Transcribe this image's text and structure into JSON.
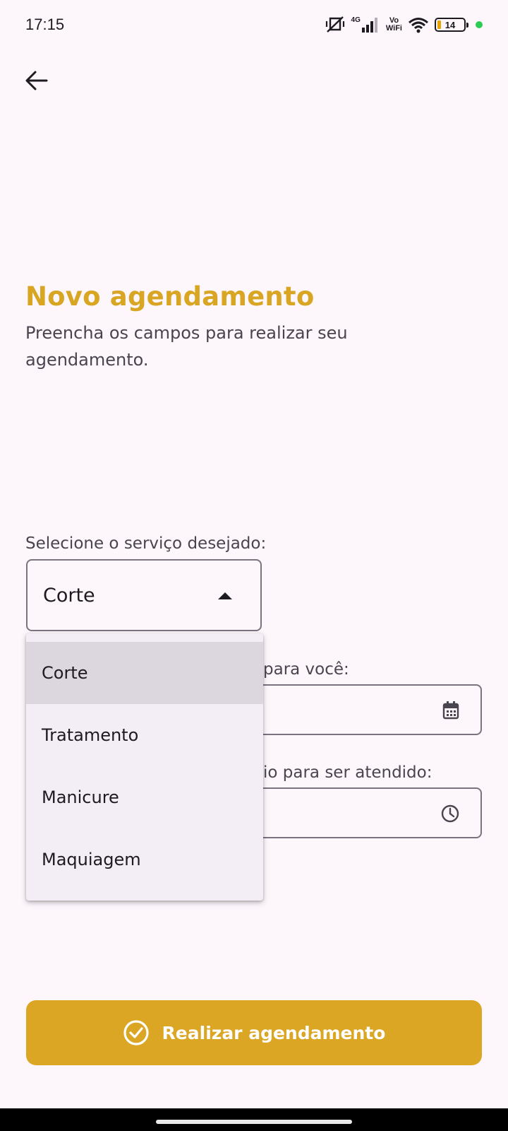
{
  "status_bar": {
    "time": "17:15",
    "network": "4G",
    "vowifi_top": "Vo",
    "vowifi_bottom": "WiFi",
    "battery": "14"
  },
  "header": {
    "back_icon": "arrow-left-icon"
  },
  "page": {
    "title": "Novo agendamento",
    "subtitle": "Preencha os campos para realizar seu agendamento."
  },
  "service": {
    "label": "Selecione o serviço desejado:",
    "selected": "Corte",
    "options": [
      "Corte",
      "Tratamento",
      "Manicure",
      "Maquiagem"
    ]
  },
  "date": {
    "label_visible": "para você:",
    "icon": "calendar-icon"
  },
  "time": {
    "label_visible": "io para ser atendido:",
    "icon": "clock-icon"
  },
  "cta": {
    "label": "Realizar agendamento",
    "icon": "check-circle-icon"
  },
  "colors": {
    "accent": "#daa624",
    "background": "#fdf7fc",
    "menu": "#f3edf6",
    "menu_selected": "#dcd6df"
  }
}
